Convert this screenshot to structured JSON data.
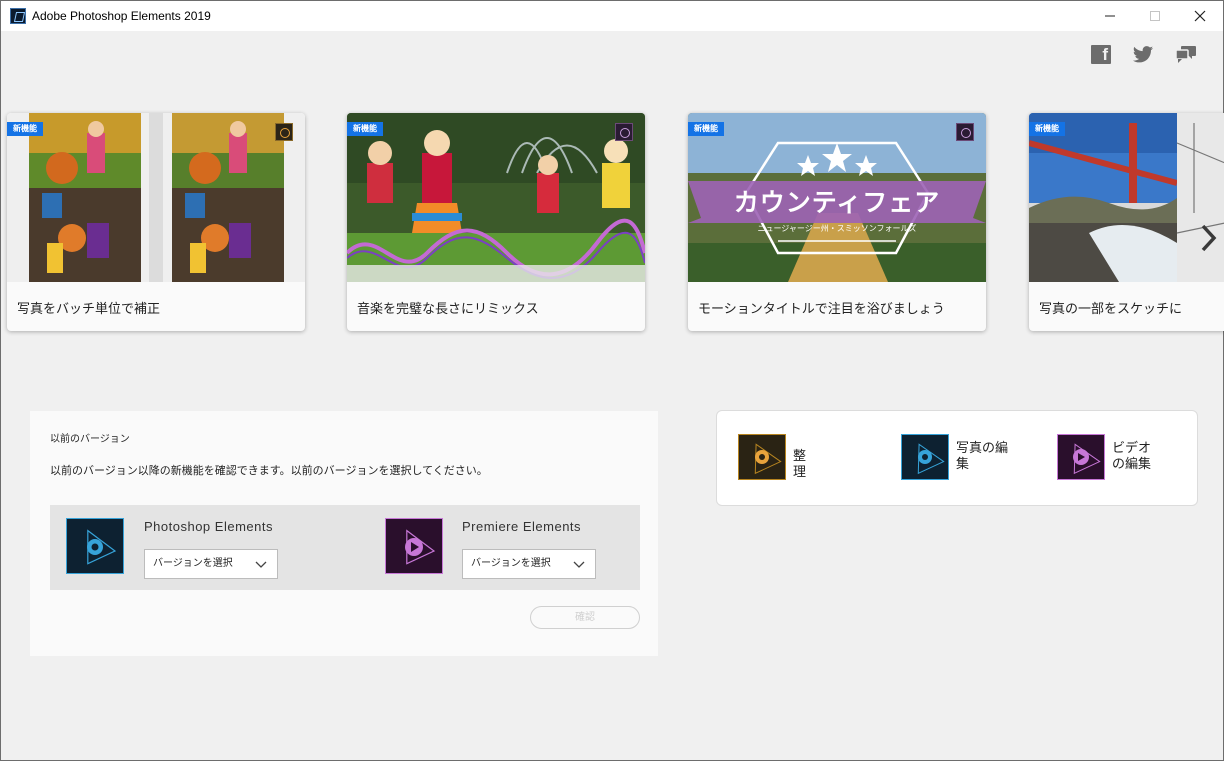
{
  "window": {
    "title": "Adobe Photoshop Elements 2019",
    "minimize_icon": "minimize-icon",
    "maximize_icon": "maximize-icon",
    "close_icon": "close-icon"
  },
  "social": {
    "icons": [
      "facebook-icon",
      "twitter-icon",
      "feedback-icon"
    ]
  },
  "carousel": {
    "prev_icon": "chevron-left-icon",
    "next_icon": "chevron-right-icon",
    "cards": [
      {
        "badge": "新機能",
        "caption": "写真をバッチ単位で補正",
        "product": "organizer"
      },
      {
        "badge": "新機能",
        "caption": "音楽を完璧な長さにリミックス",
        "product": "premiere"
      },
      {
        "badge": "新機能",
        "caption": "モーションタイトルで注目を浴びましょう",
        "product": "premiere",
        "image_title": "カウンティフェア",
        "image_subtitle": "ニュージャージー州・スミッソンフォールズ"
      },
      {
        "badge": "新機能",
        "caption": "写真の一部をスケッチに",
        "product": "photoshop"
      }
    ]
  },
  "previous_version": {
    "title": "以前のバージョン",
    "description": "以前のバージョン以降の新機能を確認できます。以前のバージョンを選択してください。",
    "photoshop": {
      "name": "Photoshop Elements",
      "select_value": "バージョンを選択"
    },
    "premiere": {
      "name": "Premiere Elements",
      "select_value": "バージョンを選択"
    },
    "ok_label": "確認"
  },
  "launcher": {
    "organizer_label": "整理",
    "photo_edit_label": "写真の編集",
    "video_edit_label": "ビデオの編集"
  },
  "colors": {
    "badge": "#1473e6",
    "photoshop_accent": "#36a3d9",
    "premiere_accent": "#c777d7",
    "organizer_accent": "#e8a33c"
  }
}
